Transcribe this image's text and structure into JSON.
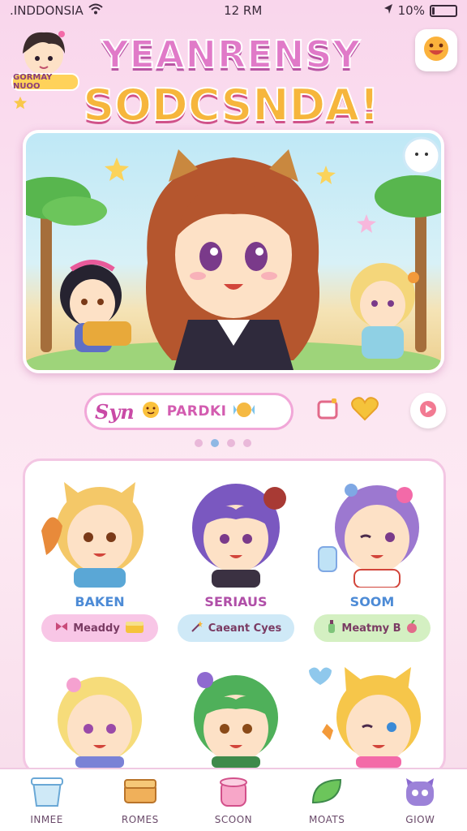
{
  "status_bar": {
    "carrier": ".INDDONSIA",
    "time": "12 RM",
    "battery": "10%",
    "battery_level": 0.1
  },
  "title": {
    "line1": "YEANRENSY",
    "line2": "SODCSNDA!"
  },
  "avatar_badge": "GORMAY NUOO",
  "promo": {
    "script_text": "Syn",
    "label": "PARDKI"
  },
  "carousel": {
    "pages": 4,
    "active_index": 1
  },
  "characters": [
    {
      "name": "BAKEN",
      "tag": "Meaddy",
      "name_color": "#4d8bd6",
      "tag_bg": "#f8c6e6"
    },
    {
      "name": "SERIAUS",
      "tag": "Caeant Cyes",
      "name_color": "#b04fa8",
      "tag_bg": "#cfe9f7"
    },
    {
      "name": "SOOM",
      "tag": "Meatmy B",
      "name_color": "#4d8bd6",
      "tag_bg": "#d4f0c2"
    }
  ],
  "bottom_nav": [
    {
      "label": "INMEE",
      "icon": "cup-icon"
    },
    {
      "label": "ROMES",
      "icon": "box-icon"
    },
    {
      "label": "SCOON",
      "icon": "jar-icon"
    },
    {
      "label": "MOATS",
      "icon": "leaf-icon"
    },
    {
      "label": "GIOW",
      "icon": "monster-icon"
    }
  ],
  "colors": {
    "accent_pink": "#e07ac8",
    "accent_gold": "#f6b63c",
    "background": "#f9d6ec"
  }
}
